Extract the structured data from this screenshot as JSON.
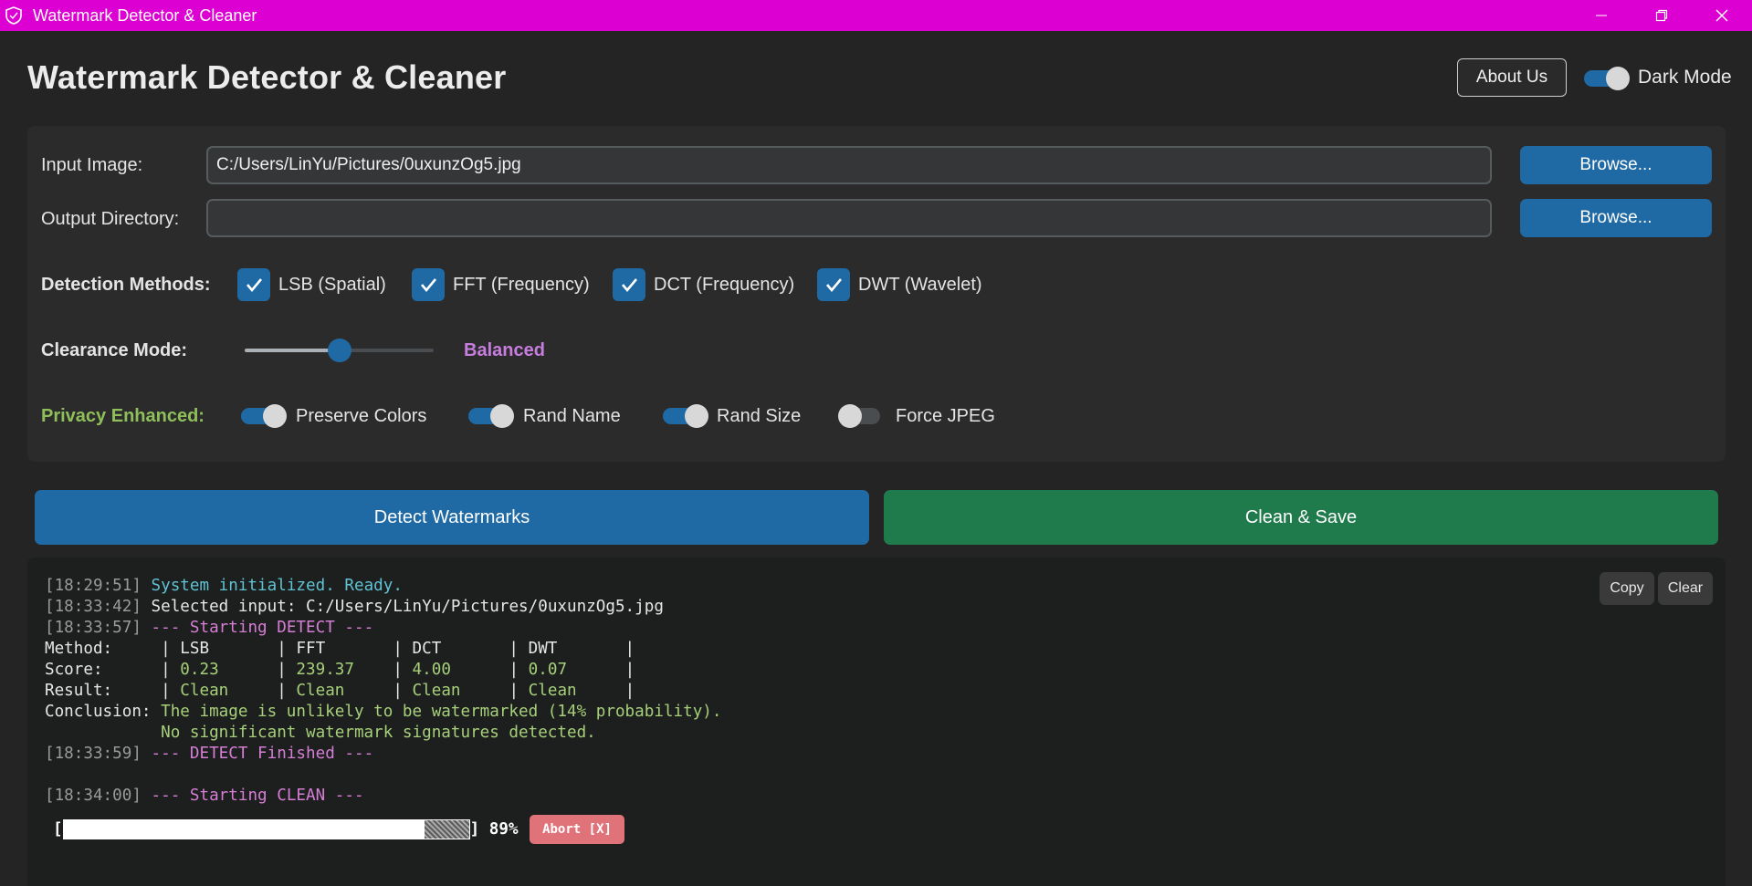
{
  "window": {
    "title": "Watermark Detector & Cleaner",
    "controls": [
      "minimize-icon",
      "restore-icon",
      "close-icon"
    ],
    "titlebar_color": "#dc00d2"
  },
  "header": {
    "title": "Watermark Detector & Cleaner",
    "about_label": "About Us",
    "dark_mode_label": "Dark Mode",
    "dark_mode_on": true
  },
  "inputs": {
    "input_image_label": "Input Image:",
    "input_image_value": "C:/Users/LinYu/Pictures/0uxunzOg5.jpg",
    "output_dir_label": "Output Directory:",
    "output_dir_value": "",
    "browse_label": "Browse..."
  },
  "detection": {
    "label": "Detection Methods:",
    "methods": [
      {
        "label": "LSB (Spatial)",
        "checked": true
      },
      {
        "label": "FFT (Frequency)",
        "checked": true
      },
      {
        "label": "DCT (Frequency)",
        "checked": true
      },
      {
        "label": "DWT (Wavelet)",
        "checked": true
      }
    ]
  },
  "clearance": {
    "label": "Clearance Mode:",
    "value_label": "Balanced",
    "value_color": "#c77dde",
    "level": 0.5
  },
  "privacy": {
    "label": "Privacy Enhanced:",
    "label_color": "#8fbf5a",
    "options": [
      {
        "label": "Preserve Colors",
        "on": true
      },
      {
        "label": "Rand Name",
        "on": true
      },
      {
        "label": "Rand Size",
        "on": true
      },
      {
        "label": "Force JPEG",
        "on": false
      }
    ]
  },
  "actions": {
    "detect_label": "Detect Watermarks",
    "detect_color": "#1f6aa5",
    "clean_label": "Clean & Save",
    "clean_color": "#1f7a4c"
  },
  "log": {
    "copy_label": "Copy",
    "clear_label": "Clear",
    "lines": {
      "l1_ts": "[18:29:51]",
      "l1_msg": "System initialized. Ready.",
      "l2_ts": "[18:33:42]",
      "l2_msg": "Selected input: C:/Users/LinYu/Pictures/0uxunzOg5.jpg",
      "l3_ts": "[18:33:57]",
      "l3_msg": "--- Starting DETECT ---",
      "table_method": "Method:     | LSB       | FFT       | DCT       | DWT       |",
      "table_score_head": "Score:      | ",
      "score_lsb": "0.23",
      "score_fft": "239.37",
      "score_dct": "4.00",
      "score_dwt": "0.07",
      "table_result_head": "Result:     | ",
      "result_lsb": "Clean",
      "result_fft": "Clean",
      "result_dct": "Clean",
      "result_dwt": "Clean",
      "conclusion_head": "Conclusion: ",
      "conclusion_1": "The image is unlikely to be watermarked (14% probability).",
      "conclusion_2": "No significant watermark signatures detected.",
      "l4_ts": "[18:33:59]",
      "l4_msg": "--- DETECT Finished ---",
      "l5_ts": "[18:34:00]",
      "l5_msg": "--- Starting CLEAN ---"
    },
    "progress": {
      "fraction": 0.89,
      "percent_label": "89%",
      "abort_label": "Abort [X]"
    }
  }
}
